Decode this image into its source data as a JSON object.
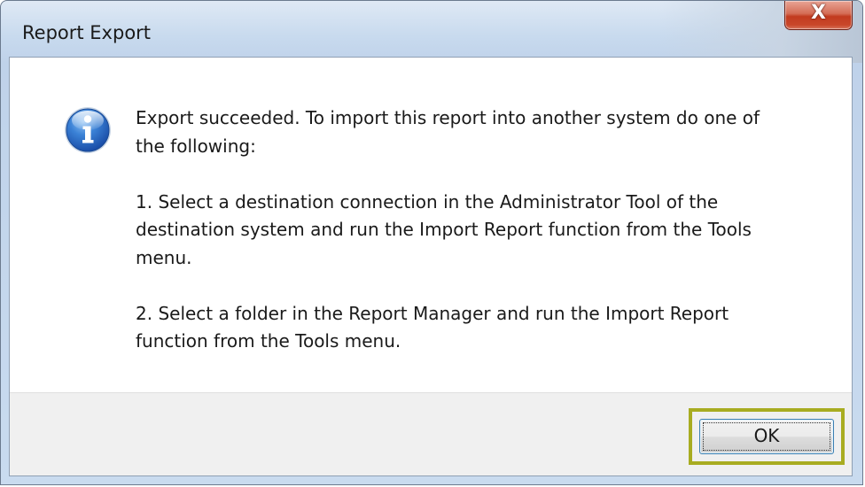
{
  "window": {
    "title": "Report Export",
    "close_glyph": "X"
  },
  "dialog": {
    "icon": "information-icon",
    "message": {
      "intro": "Export succeeded. To import this report into another system do one of\nthe following:",
      "option_1": "1. Select a destination connection in the Administrator Tool of the\ndestination system and run the Import Report function from the Tools\nmenu.",
      "option_2": "2. Select a folder in the Report Manager and run the Import Report\nfunction from the Tools menu."
    },
    "buttons": {
      "ok_label": "OK"
    }
  },
  "colors": {
    "highlight_border": "#a8ac21",
    "close_button": "#c23b1f",
    "info_icon": "#1f5fb8"
  }
}
